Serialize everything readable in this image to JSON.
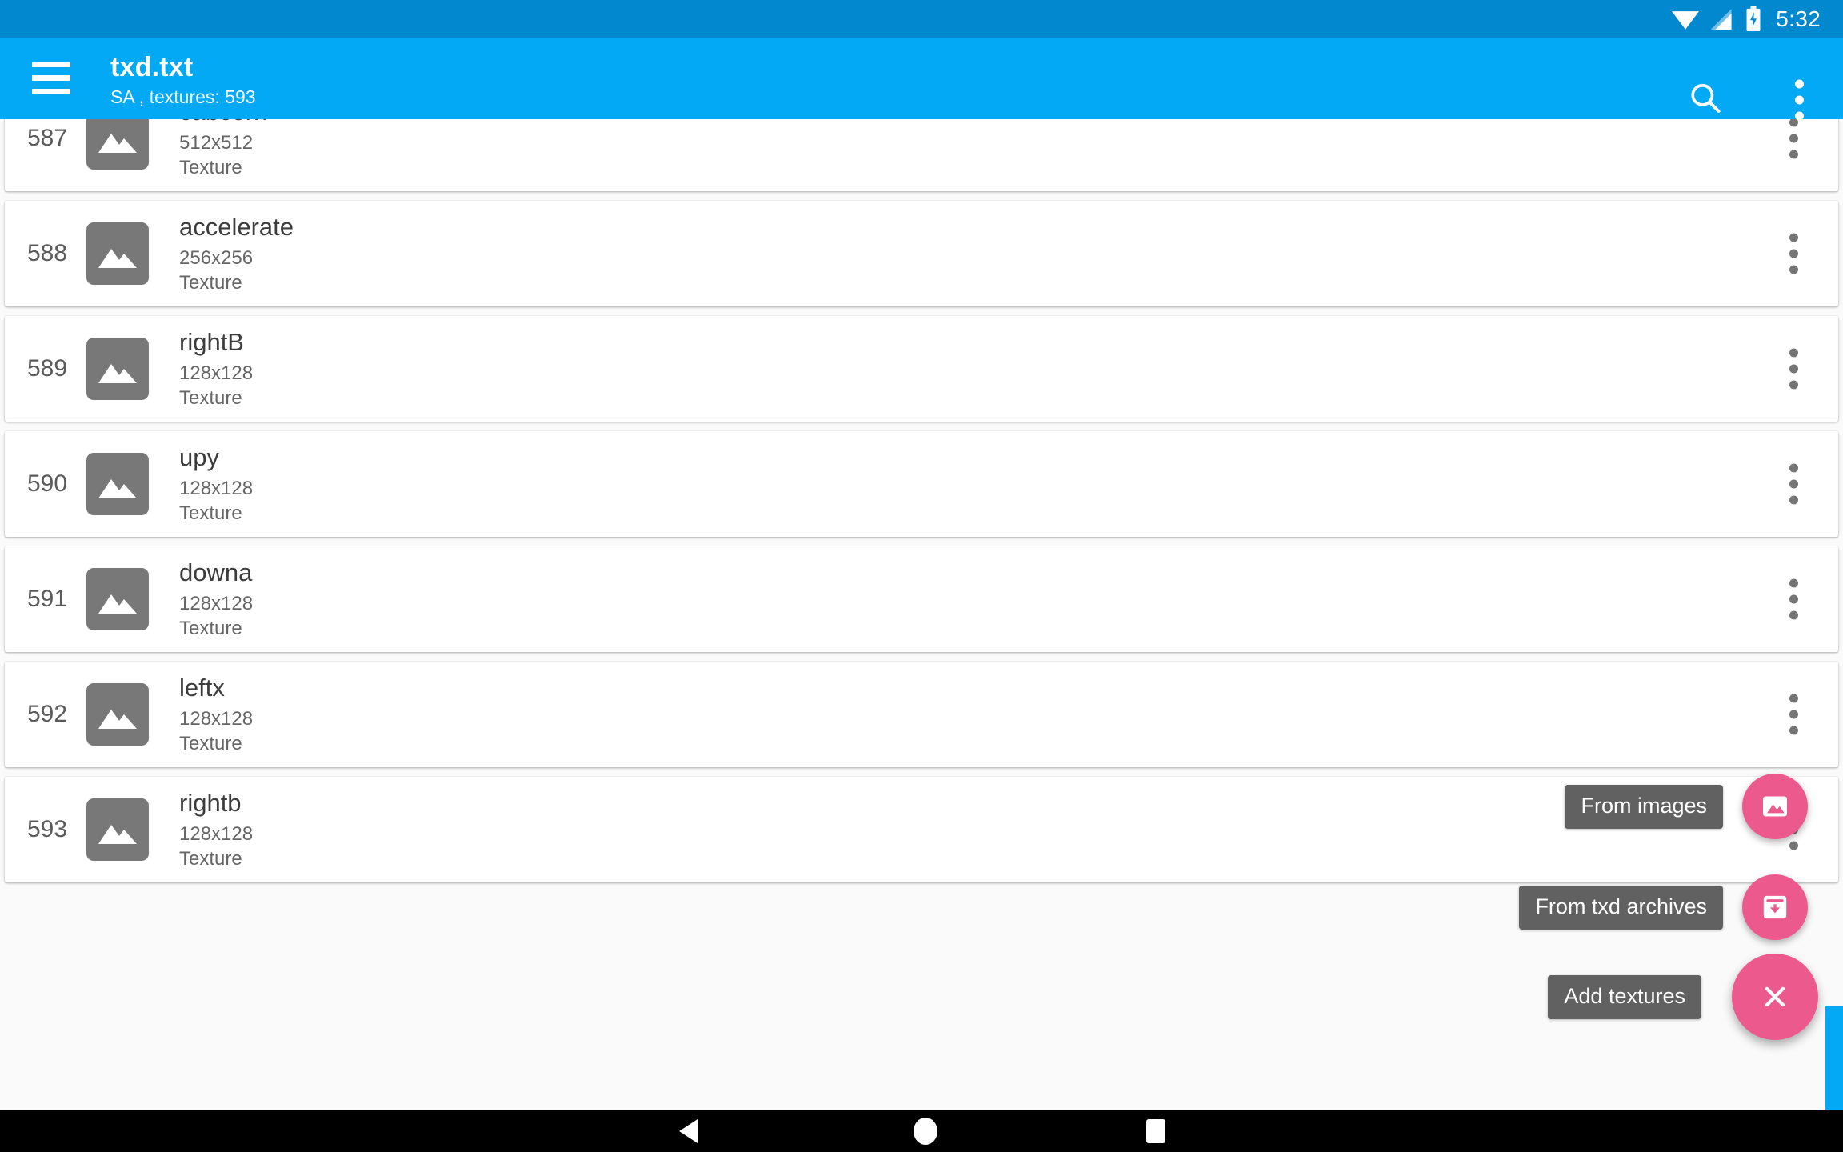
{
  "status_bar": {
    "time": "5:32",
    "icons": [
      "wifi-icon",
      "cell-signal-icon",
      "battery-charging-icon"
    ]
  },
  "toolbar": {
    "menu_icon": "hamburger-menu-icon",
    "title": "txd.txt",
    "subtitle": "SA , textures: 593",
    "search_icon": "search-icon",
    "overflow_icon": "overflow-menu-icon",
    "background_color": "#03A9F4"
  },
  "list": {
    "partial_top_row": {
      "type": "Texture"
    },
    "rows": [
      {
        "index": "587",
        "name": "cabcorn",
        "size": "512x512",
        "type": "Texture",
        "thumb": "image-placeholder-icon",
        "more": "row-overflow-icon"
      },
      {
        "index": "588",
        "name": "accelerate",
        "size": "256x256",
        "type": "Texture",
        "thumb": "image-placeholder-icon",
        "more": "row-overflow-icon"
      },
      {
        "index": "589",
        "name": "rightB",
        "size": "128x128",
        "type": "Texture",
        "thumb": "image-placeholder-icon",
        "more": "row-overflow-icon"
      },
      {
        "index": "590",
        "name": "upy",
        "size": "128x128",
        "type": "Texture",
        "thumb": "image-placeholder-icon",
        "more": "row-overflow-icon"
      },
      {
        "index": "591",
        "name": "downa",
        "size": "128x128",
        "type": "Texture",
        "thumb": "image-placeholder-icon",
        "more": "row-overflow-icon"
      },
      {
        "index": "592",
        "name": "leftx",
        "size": "128x128",
        "type": "Texture",
        "thumb": "image-placeholder-icon",
        "more": "row-overflow-icon"
      },
      {
        "index": "593",
        "name": "rightb",
        "size": "128x128",
        "type": "Texture",
        "thumb": "image-placeholder-icon",
        "more": "row-overflow-icon"
      }
    ]
  },
  "fab_menu": {
    "accent_color": "#EC5A8D",
    "label_color": "#616161",
    "expanded": true,
    "items": [
      {
        "label": "From images",
        "icon": "image-icon"
      },
      {
        "label": "From txd archives",
        "icon": "archive-download-icon"
      }
    ],
    "main": {
      "label": "Add textures",
      "icon": "close-icon"
    }
  },
  "nav_bar": {
    "back": "back-triangle-icon",
    "home": "home-circle-icon",
    "recents": "recents-square-icon"
  }
}
